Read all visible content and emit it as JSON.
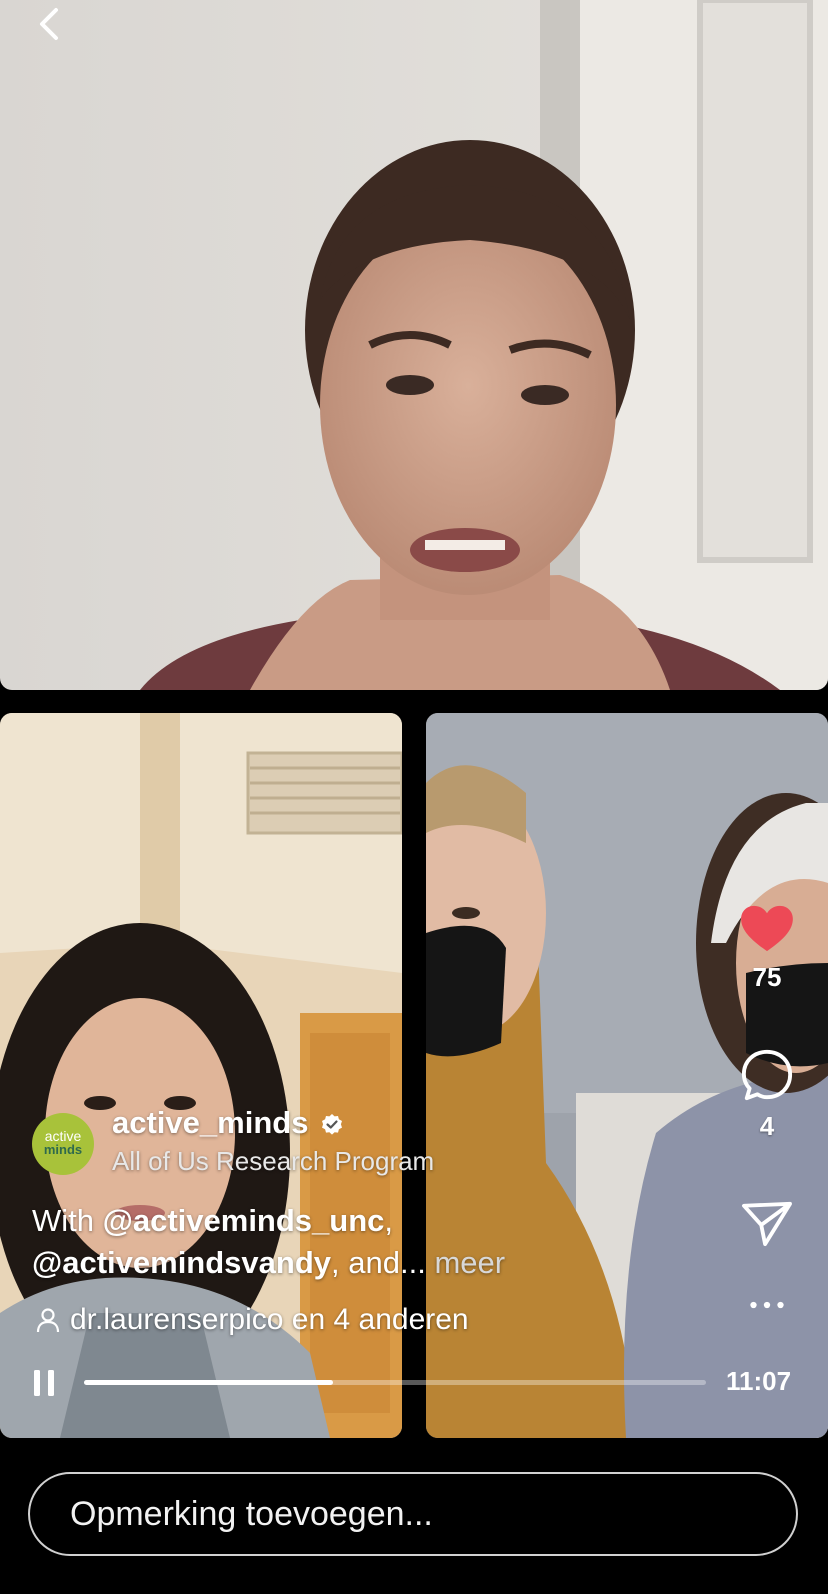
{
  "host": {
    "username": "active_minds",
    "avatar_text_top": "active",
    "avatar_text_bottom": "minds",
    "subtitle": "All of Us Research Program"
  },
  "caption": {
    "prefix": "With ",
    "mention1": "@activeminds_unc",
    "sep": ",",
    "mention2": "@activemindsvandy",
    "suffix": ", and...",
    "more_label": "meer"
  },
  "viewers_text": "dr.laurenserpico en 4 anderen",
  "actions": {
    "likes": "75",
    "comments": "4"
  },
  "playback": {
    "time": "11:07",
    "progress": 0.4
  },
  "comment_input": {
    "placeholder": "Opmerking toevoegen..."
  },
  "colors": {
    "like": "#ed4956",
    "avatar_bg": "#a8c23a"
  },
  "icons": [
    "back-arrow-icon",
    "verified-badge-icon",
    "heart-icon",
    "comment-icon",
    "share-icon",
    "more-icon",
    "person-icon",
    "pause-icon"
  ]
}
